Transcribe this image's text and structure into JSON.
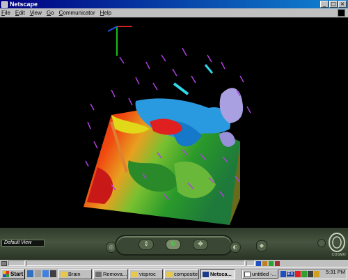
{
  "window": {
    "title": "Netscape",
    "buttons": [
      "_",
      "□",
      "×"
    ]
  },
  "menu": [
    "File",
    "Edit",
    "View",
    "Go",
    "Communicator",
    "Help"
  ],
  "viewer": {
    "current_view": "Default View",
    "logo_text": "COSMO"
  },
  "taskbar": {
    "start_label": "Start",
    "tasks": [
      {
        "label": "Brain",
        "icon": "folder-icon"
      },
      {
        "label": "Remova...",
        "icon": "app-icon"
      },
      {
        "label": "visproc",
        "icon": "folder-icon"
      },
      {
        "label": "composite",
        "icon": "folder-icon"
      },
      {
        "label": "Netsca...",
        "icon": "netscape-icon",
        "active": true
      },
      {
        "label": "untitled -...",
        "icon": "document-icon"
      }
    ],
    "tray_text": "En",
    "clock": "5:31 PM"
  },
  "colors": {
    "titlebar": "#000080",
    "chrome": "#c0c0c0",
    "panel": "#3a4734"
  }
}
